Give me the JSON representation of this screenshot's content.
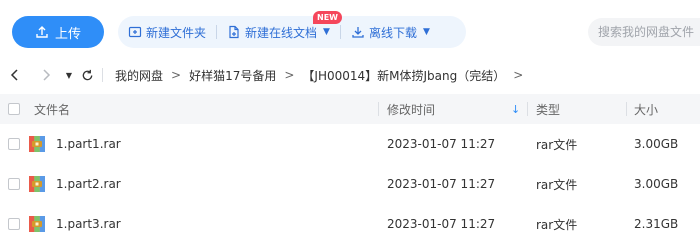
{
  "toolbar": {
    "upload_label": "上传",
    "new_folder_label": "新建文件夹",
    "new_online_doc_label": "新建在线文档",
    "new_badge": "NEW",
    "offline_download_label": "离线下载",
    "search_placeholder": "搜索我的网盘文件"
  },
  "breadcrumb": [
    "我的网盘",
    "好样猫17号备用",
    "【JH00014】新M体捞Jbang（完结）"
  ],
  "table": {
    "columns": {
      "name": "文件名",
      "modified": "修改时间",
      "type": "类型",
      "size": "大小"
    },
    "rows": [
      {
        "name": "1.part1.rar",
        "modified": "2023-01-07 11:27",
        "type": "rar文件",
        "size": "3.00GB"
      },
      {
        "name": "1.part2.rar",
        "modified": "2023-01-07 11:27",
        "type": "rar文件",
        "size": "3.00GB"
      },
      {
        "name": "1.part3.rar",
        "modified": "2023-01-07 11:27",
        "type": "rar文件",
        "size": "2.31GB"
      }
    ]
  },
  "colors": {
    "accent": "#2f8ef8",
    "badge": "#f5465b",
    "action_bg": "#eef5fd"
  }
}
